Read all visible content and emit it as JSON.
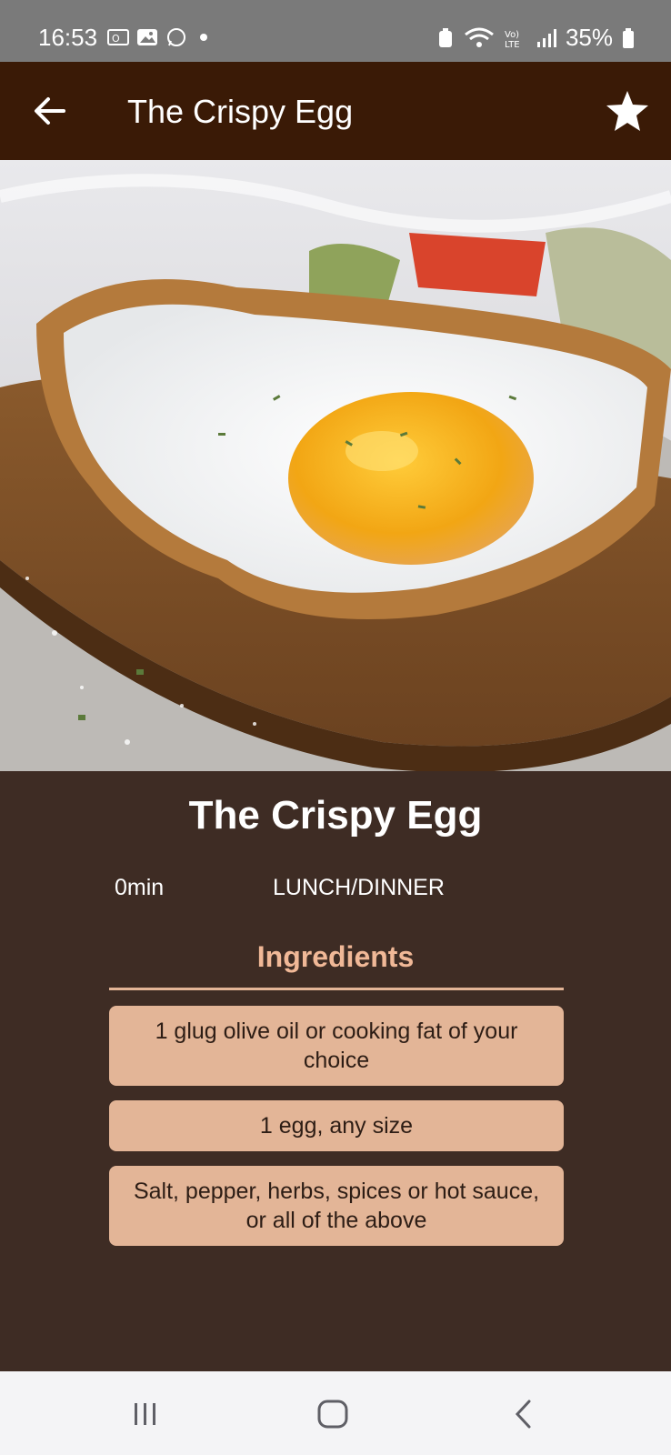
{
  "status_bar": {
    "time": "16:53",
    "battery": "35%"
  },
  "app_bar": {
    "title": "The Crispy Egg"
  },
  "recipe": {
    "title": "The Crispy Egg",
    "time": "0min",
    "category": "LUNCH/DINNER",
    "ingredients_heading": "Ingredients",
    "ingredients": [
      "1 glug olive oil or cooking fat of your choice",
      "1 egg, any size",
      "Salt, pepper, herbs, spices or hot sauce, or all of the above"
    ]
  },
  "colors": {
    "app_bar": "#3a1a06",
    "background": "#3e2c24",
    "accent": "#e3b597",
    "heading_accent": "#f0b897"
  }
}
